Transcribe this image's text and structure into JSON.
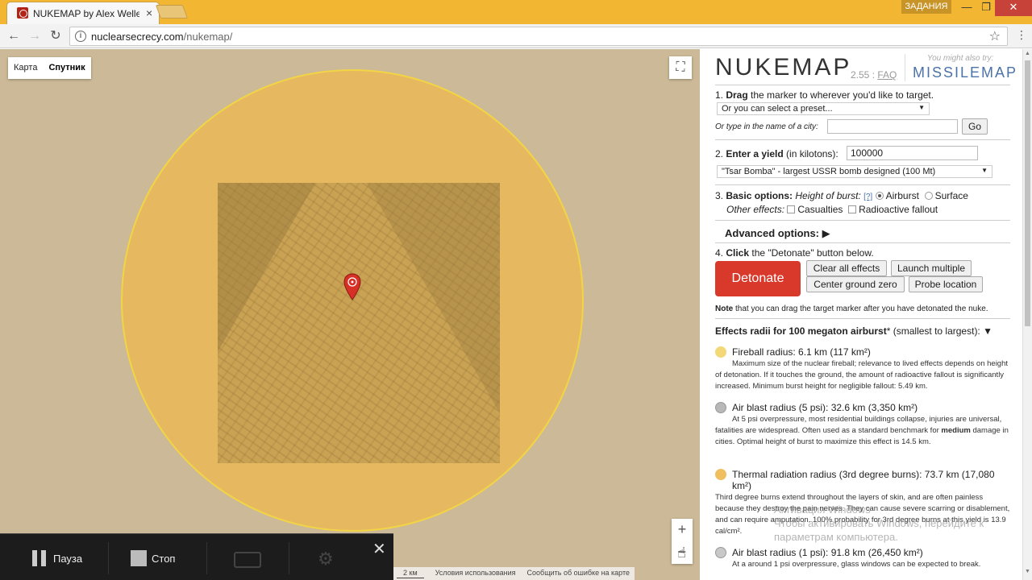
{
  "browser": {
    "tab_title": "NUKEMAP by Alex Wellerstein",
    "tab_close": "×",
    "profile_badge": "ЗАДАНИЯ",
    "url_host": "nuclearsecrecy.com",
    "url_path": "/nukemap/",
    "win_min": "—",
    "win_max": "❐",
    "win_close": "✕",
    "back": "←",
    "forward": "→",
    "reload": "↻",
    "star": "☆",
    "menu": "⋮"
  },
  "map": {
    "type_map": "Карта",
    "type_satellite": "Спутник",
    "zoom_in": "+",
    "zoom_out": "−",
    "scale": "2 км",
    "terms": "Условия использования",
    "report": "Сообщить об ошибке на карте",
    "fireball_color": "#efba4d"
  },
  "recorder": {
    "pause": "Пауза",
    "stop": "Стоп",
    "close": "✕"
  },
  "panel": {
    "brand": "NUKEMAP",
    "version": "2.55",
    "faq": "FAQ",
    "promo_text": "You might also try:",
    "missilemap": "MISSILEMAP",
    "step1_pre": "1. ",
    "step1_bold": "Drag",
    "step1_post": " the marker to wherever you'd like to target.",
    "preset_select": "Or you can select a preset...",
    "city_label": "Or type in the name of a city:",
    "city_value": "",
    "go": "Go",
    "step2_pre": "2. ",
    "step2_bold": "Enter a yield",
    "step2_post": " (in kilotons):",
    "yield_value": "100000",
    "yield_select": "\"Tsar Bomba\" - largest USSR bomb designed (100 Mt)",
    "step3_pre": "3. ",
    "step3_bold": "Basic options:",
    "height_label": "Height of burst:",
    "help_link": "[?]",
    "airburst": "Airburst",
    "surface": "Surface",
    "other_effects": "Other effects:",
    "casualties": "Casualties",
    "fallout": "Radioactive fallout",
    "advanced": "Advanced options:",
    "advanced_arrow": "▶",
    "step4_pre": "4. ",
    "step4_bold": "Click",
    "step4_post": " the \"Detonate\" button below.",
    "detonate": "Detonate",
    "clear": "Clear all effects",
    "launch": "Launch multiple",
    "center": "Center ground zero",
    "probe": "Probe location",
    "note_bold": "Note",
    "note_rest": " that you can drag the target marker after you have detonated the nuke.",
    "effects_bold": "Effects radii for 100 megaton airburst",
    "effects_star": "*",
    "effects_rest": " (smallest to largest):",
    "effects_arrow": "▼",
    "effects": [
      {
        "title": "Fireball radius: 6.1 km (117 km²)",
        "desc": "Maximum size of the nuclear fireball; relevance to lived effects depends on height of detonation. If it touches the ground, the amount of radioactive fallout is significantly increased. Minimum burst height for negligible fallout: 5.49 km.",
        "color": "#f3d878"
      },
      {
        "title": "Air blast radius (5 psi): 32.6 km (3,350 km²)",
        "desc_a": "At 5 psi overpressure, most residential buildings collapse, injuries are universal, fatalities are widespread. Often used as a standard benchmark for ",
        "desc_bold": "medium",
        "desc_b": " damage in cities. Optimal height of burst to maximize this effect is 14.5 km.",
        "color": "#b8b8b8"
      },
      {
        "title": "Thermal radiation radius (3rd degree burns): 73.7 km (17,080 km²)",
        "desc": "Third degree burns extend throughout the layers of skin, and are often painless because they destroy the pain nerves. They can cause severe scarring or disablement, and can require amputation. 100% probability for 3rd degree burns at this yield is 13.9 cal/cm².",
        "color": "#f0c060"
      },
      {
        "title": "Air blast radius (1 psi): 91.8 km (26,450 km²)",
        "desc": "At a around 1 psi overpressure, glass windows can be expected to break.",
        "color": "#c8c8c8"
      }
    ]
  },
  "watermark": {
    "line1": "Активация Windows",
    "line2": "Чтобы активировать Windows, перейдите к",
    "line3": "параметрам компьютера."
  }
}
